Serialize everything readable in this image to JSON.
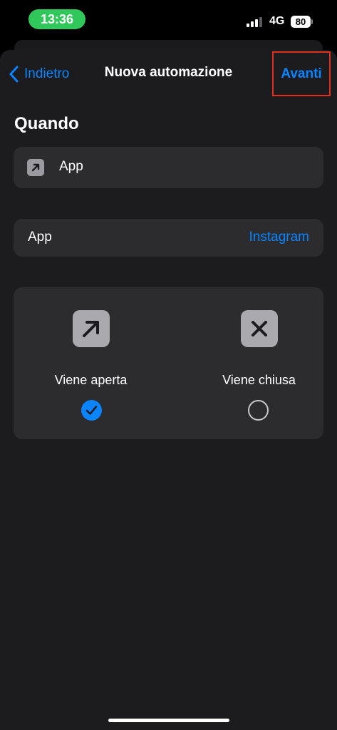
{
  "status": {
    "time": "13:36",
    "network": "4G",
    "battery": "80"
  },
  "nav": {
    "back_label": "Indietro",
    "title": "Nuova automazione",
    "next_label": "Avanti"
  },
  "section_title": "Quando",
  "trigger": {
    "label": "App",
    "icon": "arrow-up-right-square-icon"
  },
  "app_row": {
    "label": "App",
    "value": "Instagram"
  },
  "options": [
    {
      "label": "Viene aperta",
      "icon": "arrow-up-right-icon",
      "selected": true
    },
    {
      "label": "Viene chiusa",
      "icon": "xmark-icon",
      "selected": false
    }
  ],
  "colors": {
    "accent": "#0a84ff",
    "background": "#1c1c1e",
    "card": "#2c2c2e",
    "time_pill": "#30c85a",
    "highlight": "#e0301e"
  }
}
